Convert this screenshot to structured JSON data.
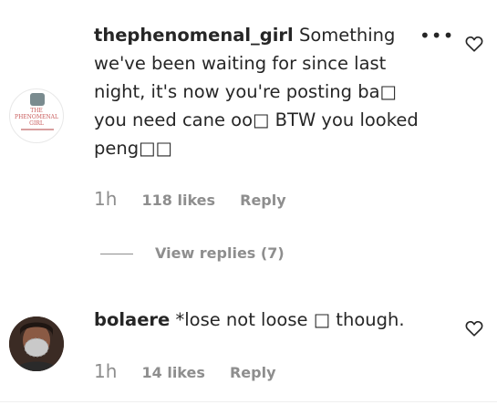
{
  "comments": [
    {
      "username": "thephenomenal_girl",
      "text": "Something we've been waiting for since last night, it's now you're posting ba□ you need cane oo□ BTW you looked peng□□",
      "time": "1h",
      "likes": "118 likes",
      "reply_label": "Reply",
      "avatar": {
        "text": "THE PHENOMENAL GIRL"
      }
    },
    {
      "username": "bolaere",
      "text": "*lose not loose □ though.",
      "time": "1h",
      "likes": "14 likes",
      "reply_label": "Reply"
    }
  ],
  "view_replies_label": "View replies (7)",
  "icons": {
    "more": "more-options-icon",
    "like": "heart-icon"
  },
  "colors": {
    "text": "#262626",
    "secondary": "#8e8e8e",
    "divider": "#efefef"
  }
}
